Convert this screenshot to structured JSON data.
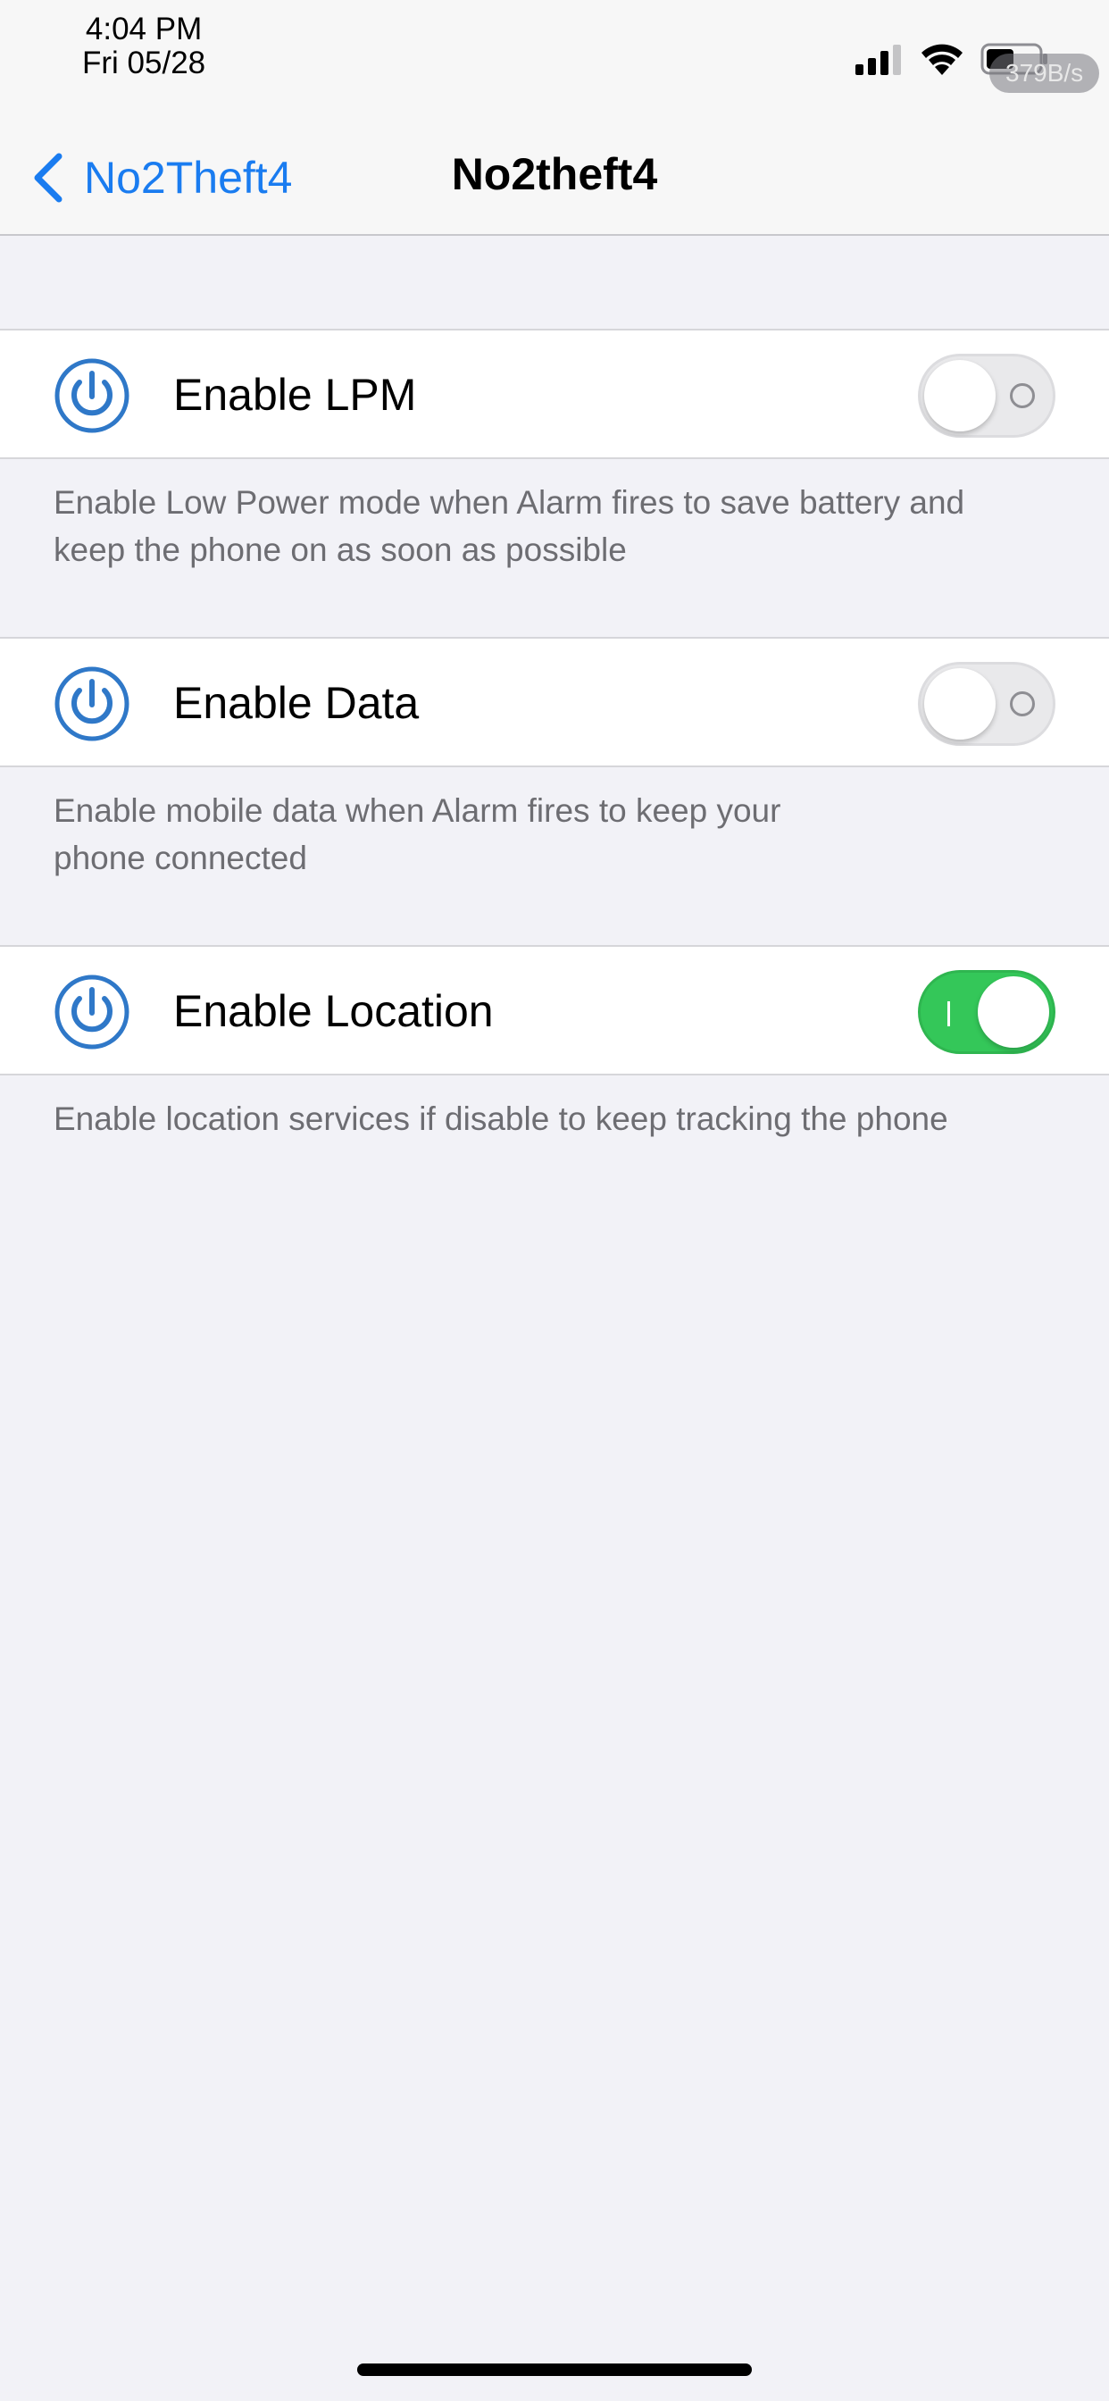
{
  "status_bar": {
    "time": "4:04 PM",
    "date": "Fri 05/28",
    "network_speed": "379B/s",
    "signal_icon": "cellular-signal-icon",
    "wifi_icon": "wifi-icon",
    "battery_icon": "battery-icon"
  },
  "nav": {
    "back_label": "No2Theft4",
    "title": "No2theft4",
    "accent_color": "#1a7cf0"
  },
  "settings": [
    {
      "label": "Enable LPM",
      "footer_line1": "Enable Low Power mode when Alarm fires to save battery and",
      "footer_line2": "keep the phone on as soon as possible",
      "enabled": false,
      "icon": "power-icon"
    },
    {
      "label": "Enable Data",
      "footer_line1": "Enable mobile data when Alarm fires to keep your",
      "footer_line2": "phone connected",
      "enabled": false,
      "icon": "power-icon"
    },
    {
      "label": "Enable Location",
      "footer_line1": "Enable location services if disable to keep tracking the phone",
      "footer_line2": "",
      "enabled": true,
      "icon": "power-icon"
    }
  ],
  "colors": {
    "toggle_on": "#34c759",
    "icon_blue": "#2f78c8",
    "background": "#f2f2f7"
  }
}
